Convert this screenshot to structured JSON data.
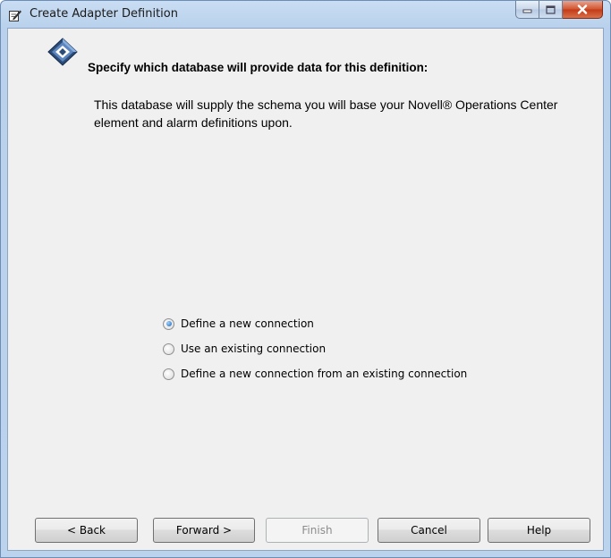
{
  "window": {
    "title": "Create Adapter Definition",
    "title_icon": "edit-document-icon",
    "caption_buttons": [
      "minimize-icon",
      "maximize-icon",
      "close-icon"
    ]
  },
  "header": {
    "icon": "novell-diamond-logo-icon",
    "heading": "Specify which database will provide data for this definition:",
    "description": "This database will supply the schema you will base your Novell® Operations Center element and alarm definitions upon."
  },
  "options": [
    {
      "label": "Define a new connection",
      "selected": true
    },
    {
      "label": "Use an existing connection",
      "selected": false
    },
    {
      "label": "Define a new connection from an existing connection",
      "selected": false
    }
  ],
  "buttons": {
    "back": "< Back",
    "forward": "Forward >",
    "finish": "Finish",
    "cancel": "Cancel",
    "help": "Help"
  },
  "colors": {
    "titlebar": "#c9ddf3",
    "client_background": "#f0f0f0",
    "close_button": "#c23a15",
    "radio_selected": "#1a5fb4"
  }
}
